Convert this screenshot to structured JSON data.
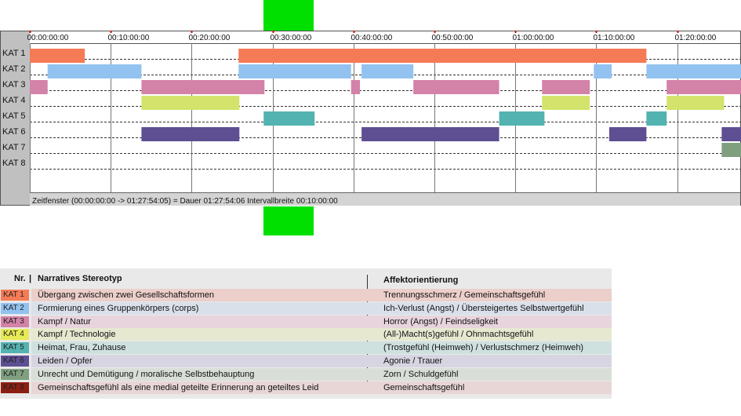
{
  "chart_data": {
    "type": "timeline",
    "unit": "minutes",
    "axis_range_min": [
      0,
      87.9
    ],
    "tick_minutes": [
      0,
      10,
      20,
      30,
      40,
      50,
      60,
      70,
      80
    ],
    "tick_labels": [
      "00:00:00:00",
      "00:10:00:00",
      "00:20:00:00",
      "00:30:00:00",
      "00:40:00:00",
      "00:50:00:00",
      "01:00:00:00",
      "01:10:00:00",
      "01:20:00:00"
    ],
    "grid": true,
    "categories": [
      "KAT 1",
      "KAT 2",
      "KAT 3",
      "KAT 4",
      "KAT 5",
      "KAT 6",
      "KAT 7",
      "KAT 8"
    ],
    "segments": [
      {
        "cat": 0,
        "start": 0.0,
        "end": 6.8
      },
      {
        "cat": 0,
        "start": 25.8,
        "end": 76.2
      },
      {
        "cat": 1,
        "start": 2.2,
        "end": 13.8
      },
      {
        "cat": 1,
        "start": 25.8,
        "end": 39.7
      },
      {
        "cat": 1,
        "start": 41.0,
        "end": 47.4
      },
      {
        "cat": 1,
        "start": 69.7,
        "end": 71.9
      },
      {
        "cat": 1,
        "start": 76.2,
        "end": 87.9
      },
      {
        "cat": 2,
        "start": 0.0,
        "end": 2.2
      },
      {
        "cat": 2,
        "start": 13.8,
        "end": 29.0
      },
      {
        "cat": 2,
        "start": 39.7,
        "end": 40.8
      },
      {
        "cat": 2,
        "start": 47.4,
        "end": 58.0
      },
      {
        "cat": 2,
        "start": 63.3,
        "end": 69.2
      },
      {
        "cat": 2,
        "start": 78.7,
        "end": 87.9
      },
      {
        "cat": 3,
        "start": 13.8,
        "end": 25.9
      },
      {
        "cat": 3,
        "start": 63.3,
        "end": 69.2
      },
      {
        "cat": 3,
        "start": 78.7,
        "end": 85.8
      },
      {
        "cat": 4,
        "start": 28.9,
        "end": 35.2
      },
      {
        "cat": 4,
        "start": 58.0,
        "end": 63.6
      },
      {
        "cat": 4,
        "start": 76.2,
        "end": 78.7
      },
      {
        "cat": 5,
        "start": 13.8,
        "end": 25.9
      },
      {
        "cat": 5,
        "start": 41.0,
        "end": 58.0
      },
      {
        "cat": 5,
        "start": 71.6,
        "end": 76.2
      },
      {
        "cat": 5,
        "start": 85.5,
        "end": 87.9
      },
      {
        "cat": 6,
        "start": 85.5,
        "end": 87.9
      }
    ],
    "status_text": "Zeitfenster (00:00:00:00 -> 01:27:54:05) = Dauer 01:27:54:06    Intervallbreite 00:10:00:00"
  },
  "colors": {
    "KAT 1": "#f57b57",
    "KAT 2": "#92c2f0",
    "KAT 3": "#d382a8",
    "KAT 4": "#d3e36b",
    "KAT 5": "#52b3b0",
    "KAT 6": "#5e4f92",
    "KAT 7": "#7f9f7f",
    "KAT 8": "#8c1e12"
  },
  "legend": {
    "header_nr": "Nr.",
    "header_stereotyp": "Narratives Stereotyp",
    "header_affekt": "Affektorientierung",
    "rows": [
      {
        "nr": "KAT 1",
        "stereotyp": "Übergang zwischen zwei Gesellschaftsformen",
        "affekt": "Trennungsschmerz / Gemeinschaftsgefühl",
        "badge": "#f57b57",
        "rowbg": "#eccfca"
      },
      {
        "nr": "KAT 2",
        "stereotyp": "Formierung eines Gruppenkörpers (corps)",
        "affekt": "Ich-Verlust (Angst) / Übersteigertes Selbstwertgefühl",
        "badge": "#92c2f0",
        "rowbg": "#d9e0ea"
      },
      {
        "nr": "KAT 3",
        "stereotyp": "Kampf / Natur",
        "affekt": "Horror (Angst) / Feindseligkeit",
        "badge": "#d382a8",
        "rowbg": "#e8d4dd"
      },
      {
        "nr": "KAT 4",
        "stereotyp": "Kampf / Technologie",
        "affekt": "(All-)Macht(s)gefühl / Ohnmachtsgefühl",
        "badge": "#e6ea55",
        "rowbg": "#e6e8d0"
      },
      {
        "nr": "KAT 5",
        "stereotyp": "Heimat, Frau, Zuhause",
        "affekt": "(Trostgefühl (Heimweh) / Verlustschmerz (Heimweh)",
        "badge": "#52b3b0",
        "rowbg": "#cfe1df"
      },
      {
        "nr": "KAT 6",
        "stereotyp": "Leiden / Opfer",
        "affekt": "Agonie / Trauer",
        "badge": "#5e4f92",
        "rowbg": "#d8d5e2"
      },
      {
        "nr": "KAT 7",
        "stereotyp": "Unrecht und Demütigung / moralische Selbstbehauptung",
        "affekt": "Zorn / Schuldgefühl",
        "badge": "#7f9f7f",
        "rowbg": "#d9dfd8"
      },
      {
        "nr": "KAT 8",
        "stereotyp": "Gemeinschaftsgefühl als eine medial geteilte Erinnerung an geteiltes Leid",
        "affekt": "Gemeinschaftsgefühl",
        "badge": "#8c1e12",
        "rowbg": "#e8d6d6"
      }
    ]
  }
}
